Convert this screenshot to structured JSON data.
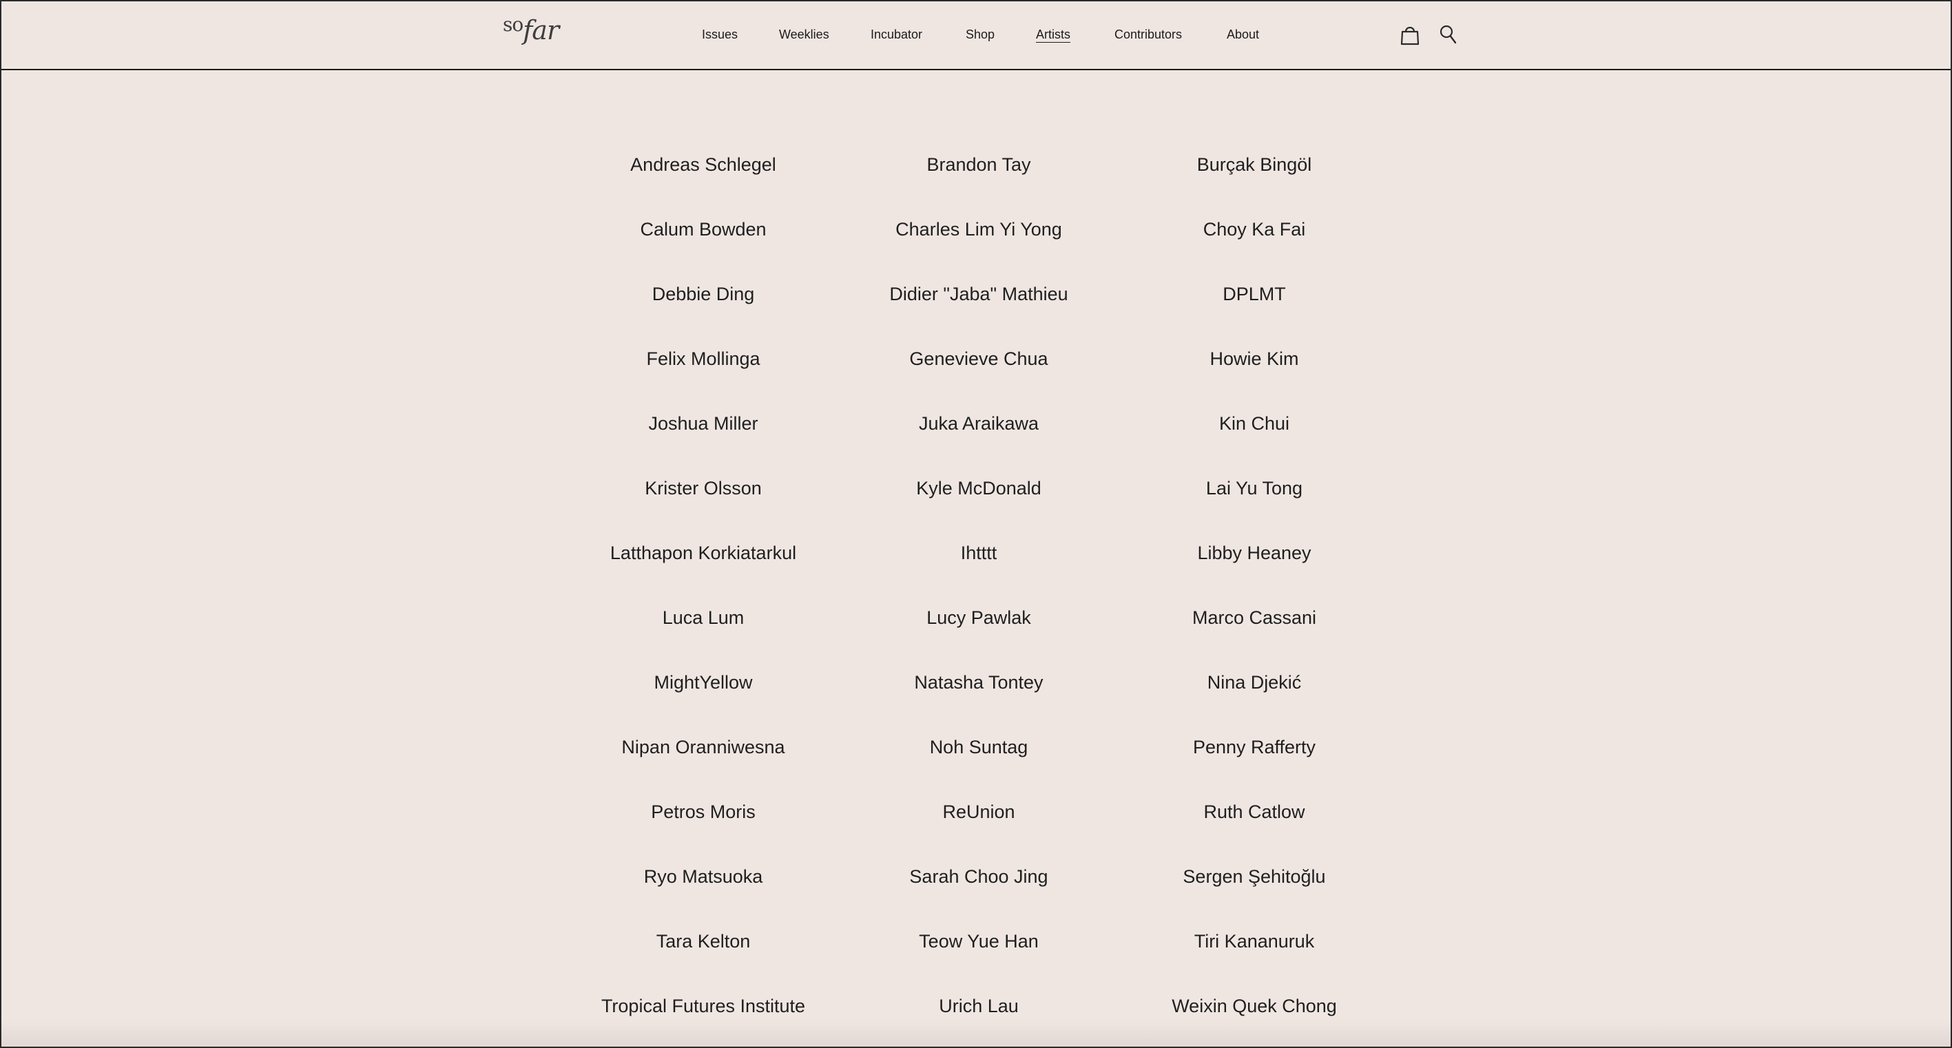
{
  "brand": {
    "logo_so": "so",
    "logo_far": "far"
  },
  "nav": {
    "items": [
      {
        "label": "Issues",
        "active": false
      },
      {
        "label": "Weeklies",
        "active": false
      },
      {
        "label": "Incubator",
        "active": false
      },
      {
        "label": "Shop",
        "active": false
      },
      {
        "label": "Artists",
        "active": true
      },
      {
        "label": "Contributors",
        "active": false
      },
      {
        "label": "About",
        "active": false
      }
    ],
    "icons": [
      "shopping-bag-icon",
      "search-icon"
    ]
  },
  "artists": [
    [
      "Andreas Schlegel",
      "Brandon Tay",
      "Burçak Bingöl"
    ],
    [
      "Calum Bowden",
      "Charles Lim Yi Yong",
      "Choy Ka Fai"
    ],
    [
      "Debbie Ding",
      "Didier \"Jaba\" Mathieu",
      "DPLMT"
    ],
    [
      "Felix Mollinga",
      "Genevieve Chua",
      "Howie Kim"
    ],
    [
      "Joshua Miller",
      "Juka Araikawa",
      "Kin Chui"
    ],
    [
      "Krister Olsson",
      "Kyle McDonald",
      "Lai Yu Tong"
    ],
    [
      "Latthapon Korkiatarkul",
      "Ihtttt",
      "Libby Heaney"
    ],
    [
      "Luca Lum",
      "Lucy Pawlak",
      "Marco Cassani"
    ],
    [
      "MightYellow",
      "Natasha Tontey",
      "Nina Djekić"
    ],
    [
      "Nipan Oranniwesna",
      "Noh Suntag",
      "Penny Rafferty"
    ],
    [
      "Petros Moris",
      "ReUnion",
      "Ruth Catlow"
    ],
    [
      "Ryo Matsuoka",
      "Sarah Choo Jing",
      "Sergen Şehitoğlu"
    ],
    [
      "Tara Kelton",
      "Teow Yue Han",
      "Tiri Kananuruk"
    ],
    [
      "Tropical Futures Institute",
      "Urich Lau",
      "Weixin Quek Chong"
    ]
  ],
  "colors": {
    "background": "#efe6e2",
    "text": "#1f1f1f",
    "border": "#1a1a1a"
  }
}
